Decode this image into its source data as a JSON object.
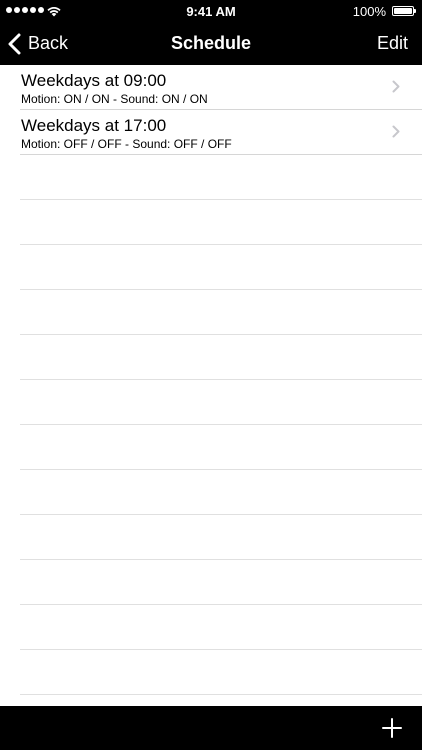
{
  "status_bar": {
    "time": "9:41 AM",
    "battery_percent": "100%",
    "signal_dots": 5,
    "battery_level": 1.0
  },
  "nav": {
    "back_label": "Back",
    "title": "Schedule",
    "edit_label": "Edit"
  },
  "schedules": [
    {
      "title": "Weekdays at 09:00",
      "subtitle": "Motion: ON / ON - Sound: ON / ON"
    },
    {
      "title": "Weekdays at 17:00",
      "subtitle": "Motion: OFF / OFF - Sound: OFF / OFF"
    }
  ],
  "toolbar": {
    "add_icon": "plus-icon"
  },
  "colors": {
    "bar_background": "#000000",
    "bar_foreground": "#ffffff",
    "separator": "#d6d6d6",
    "chevron": "#c7c7cc"
  }
}
